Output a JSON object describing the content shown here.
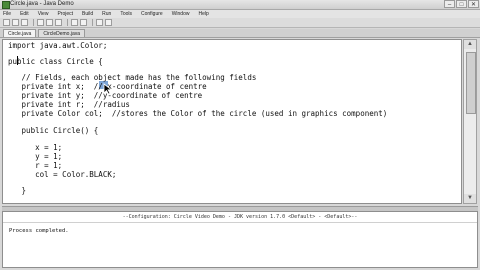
{
  "window": {
    "title": "Circle.java - Java Demo"
  },
  "menu": [
    "File",
    "Edit",
    "View",
    "Project",
    "Build",
    "Run",
    "Tools",
    "Configure",
    "Window",
    "Help"
  ],
  "tabs": [
    {
      "label": "Circle.java",
      "active": true
    },
    {
      "label": "CircleDemo.java",
      "active": false
    }
  ],
  "code": [
    "import java.awt.Color;",
    "",
    "public class Circle {",
    "",
    "   // Fields, each object made has the following fields",
    "   private int x;  // x-coordinate of centre",
    "   private int y;  //y-coordinate of centre",
    "   private int r;  //radius",
    "   private Color col;  //stores the Color of the circle (used in graphics component)",
    "",
    "   public Circle() {",
    "",
    "",
    "      x = 1;",
    "      y = 1;",
    "      r = 1;",
    "      col = Color.BLACK;",
    "",
    "   }"
  ],
  "output": {
    "header": "--Configuration: Circle Video Demo - JDK version 1.7.0 <Default> - <Default>--",
    "text": "Process completed."
  },
  "colors": {
    "selection": "#7fa6d8",
    "editor_bg": "#ffffff",
    "chrome_bg": "#d8d8d8"
  }
}
